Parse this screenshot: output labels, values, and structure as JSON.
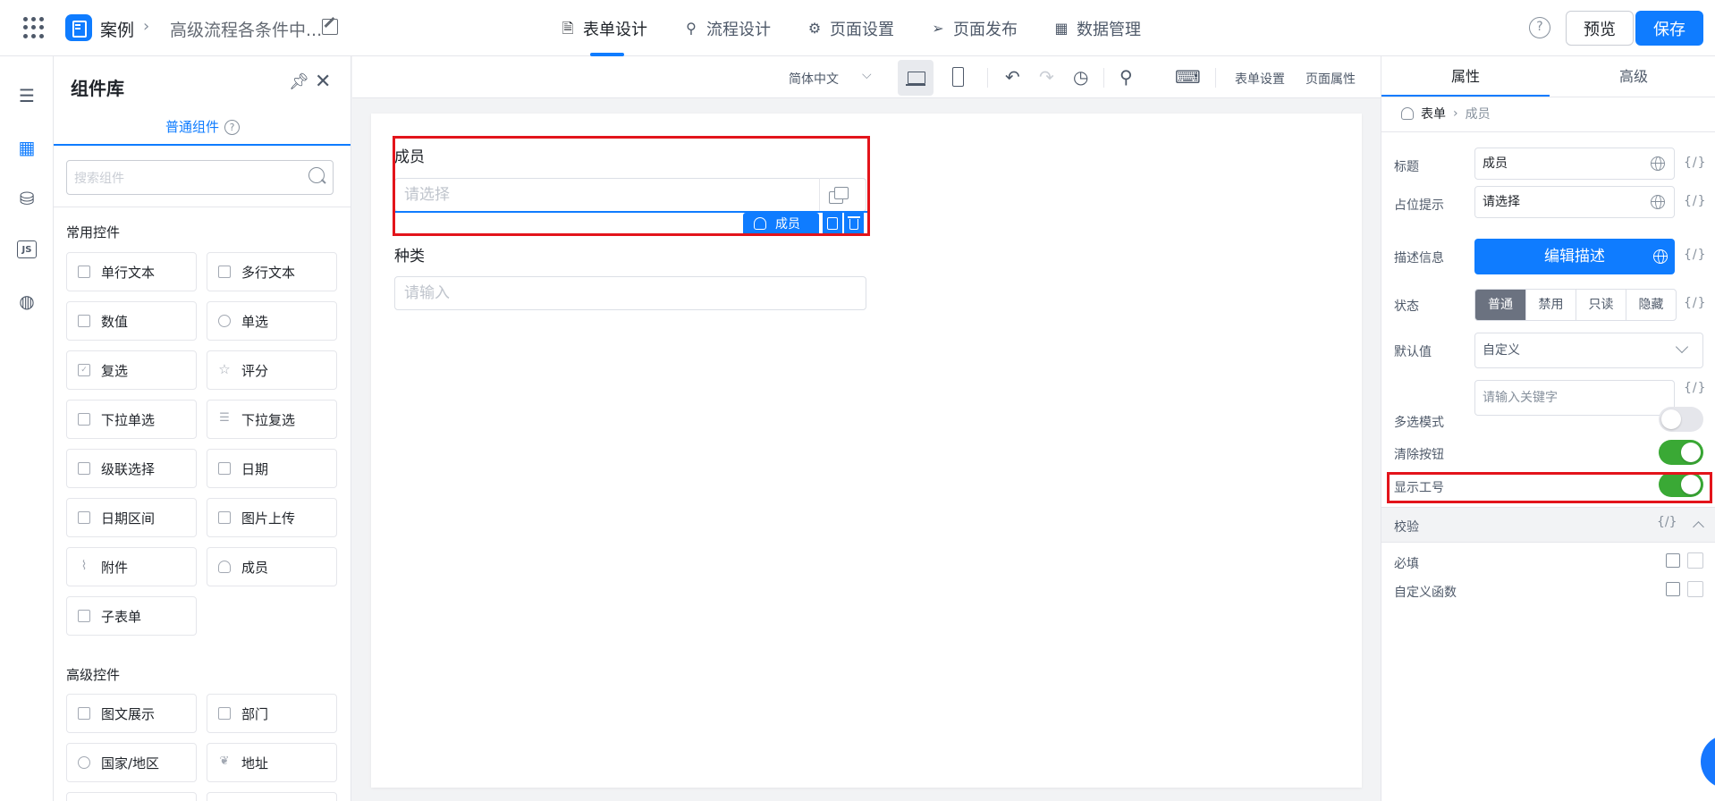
{
  "header": {
    "app_name": "案例",
    "page_name": "高级流程各条件中...",
    "tabs": [
      {
        "label": "表单设计",
        "icon": "document-icon",
        "active": true
      },
      {
        "label": "流程设计",
        "icon": "flow-icon",
        "active": false
      },
      {
        "label": "页面设置",
        "icon": "gear-icon",
        "active": false
      },
      {
        "label": "页面发布",
        "icon": "send-icon",
        "active": false
      },
      {
        "label": "数据管理",
        "icon": "grid-icon",
        "active": false
      }
    ],
    "help": "?",
    "preview_label": "预览",
    "save_label": "保存"
  },
  "library": {
    "title": "组件库",
    "tab_label": "普通组件",
    "tab_help": "?",
    "search_placeholder": "搜索组件",
    "groups": [
      {
        "title": "常用控件",
        "items": [
          "单行文本",
          "多行文本",
          "数值",
          "单选",
          "复选",
          "评分",
          "下拉单选",
          "下拉复选",
          "级联选择",
          "日期",
          "日期区间",
          "图片上传",
          "附件",
          "成员",
          "子表单"
        ]
      },
      {
        "title": "高级控件",
        "items": [
          "图文展示",
          "部门",
          "国家/地区",
          "地址"
        ]
      }
    ]
  },
  "toolbar": {
    "language": "简体中文",
    "form_settings": "表单设置",
    "page_props": "页面属性"
  },
  "canvas": {
    "fields": [
      {
        "label": "成员",
        "placeholder": "请选择",
        "tag": "成员",
        "selected": true
      },
      {
        "label": "种类",
        "placeholder": "请输入",
        "selected": false
      }
    ]
  },
  "props": {
    "tabs": [
      "属性",
      "高级"
    ],
    "breadcrumb": {
      "root": "表单",
      "current": "成员"
    },
    "braces": "{/}",
    "title_label": "标题",
    "title_value": "成员",
    "placeholder_label": "占位提示",
    "placeholder_value": "请选择",
    "desc_label": "描述信息",
    "desc_button": "编辑描述",
    "state_label": "状态",
    "states": [
      "普通",
      "禁用",
      "只读",
      "隐藏"
    ],
    "active_state": "普通",
    "default_label": "默认值",
    "default_value": "自定义",
    "keyword_placeholder": "请输入关键字",
    "multi_label": "多选模式",
    "multi_on": false,
    "clear_label": "清除按钮",
    "clear_on": true,
    "show_id_label": "显示工号",
    "show_id_on": true,
    "validation_title": "校验",
    "required_label": "必填",
    "custom_func_label": "自定义函数"
  },
  "colors": {
    "accent": "#0f7cff",
    "toggle_on": "#3aa935",
    "highlight_red": "#e3141b"
  }
}
